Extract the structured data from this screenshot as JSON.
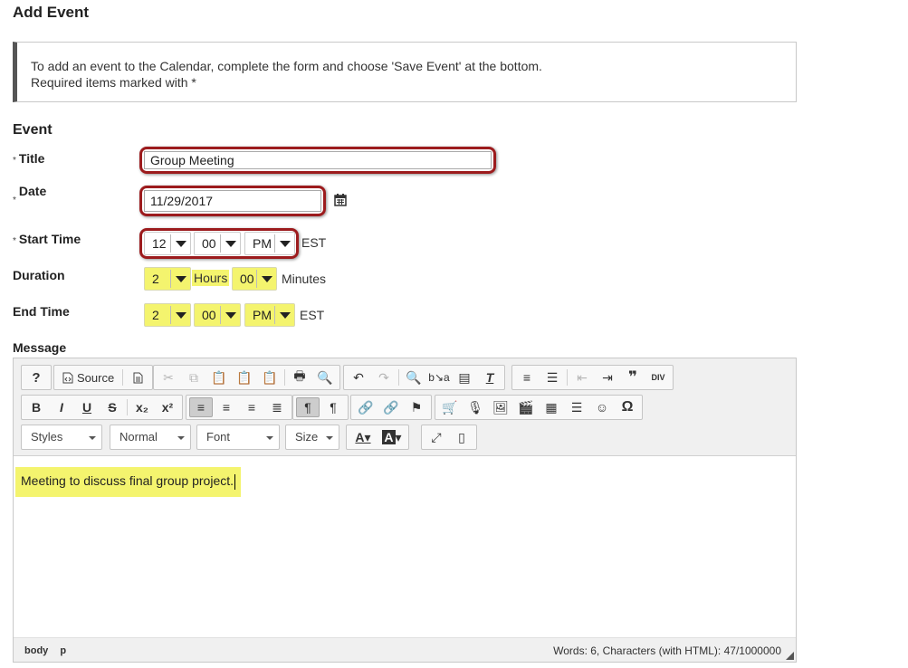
{
  "page": {
    "title": "Add Event",
    "instructions_line1": "To add an event to the Calendar, complete the form and choose 'Save Event' at the bottom.",
    "instructions_line2": "Required items marked with *"
  },
  "form": {
    "section_title": "Event",
    "required_marker": "*",
    "title_label": "Title",
    "title_value": "Group Meeting",
    "date_label": "Date",
    "date_value": "11/29/2017",
    "calendar_icon": "calendar-icon",
    "start_label": "Start Time",
    "start_hour": "12",
    "start_minute": "00",
    "start_ampm": "PM",
    "start_tz": "EST",
    "duration_label": "Duration",
    "duration_hours": "2",
    "duration_hours_unit": "Hours",
    "duration_minutes": "00",
    "duration_minutes_unit": "Minutes",
    "end_label": "End Time",
    "end_hour": "2",
    "end_minute": "00",
    "end_ampm": "PM",
    "end_tz": "EST",
    "message_label": "Message"
  },
  "editor": {
    "source_label": "Source",
    "styles_label": "Styles",
    "format_label": "Normal",
    "font_label": "Font",
    "size_label": "Size",
    "content": "Meeting to discuss final group project.",
    "path": [
      "body",
      "p"
    ],
    "word_count": "Words: 6, Characters (with HTML): 47/1000000"
  },
  "colors": {
    "highlight_red": "#9c1b1d",
    "highlight_yellow": "#f4f46e"
  }
}
